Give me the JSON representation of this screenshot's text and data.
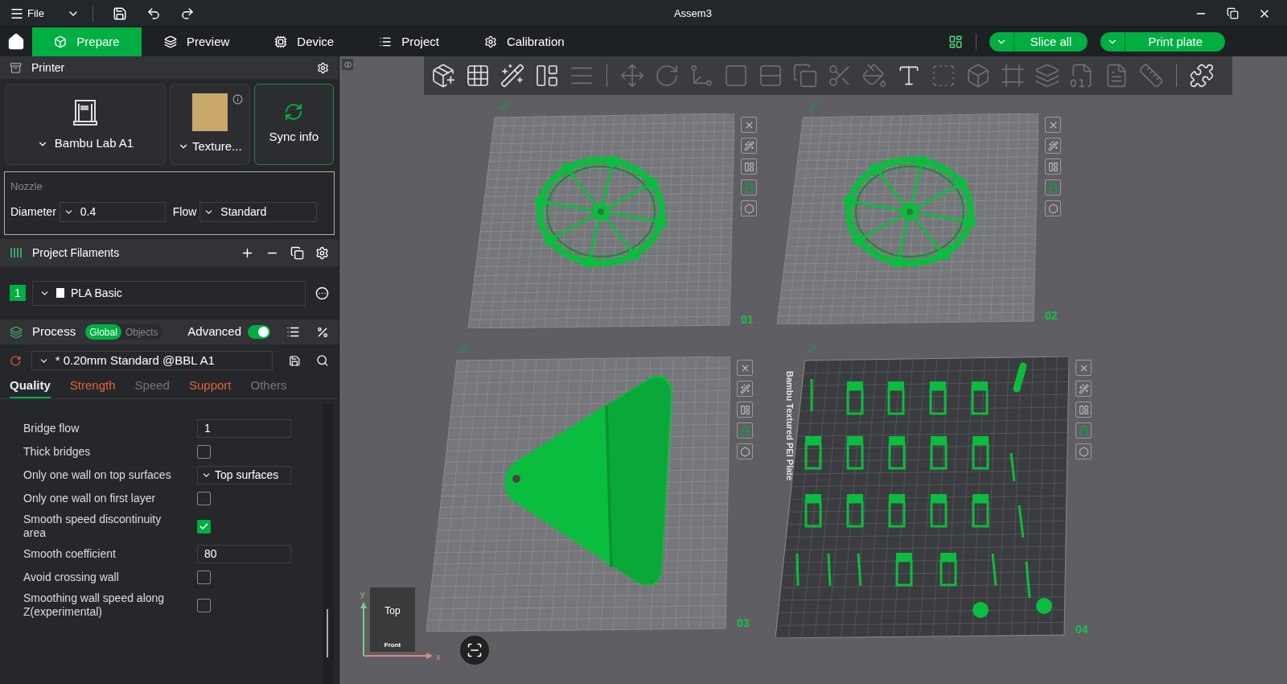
{
  "title_bar": {
    "menu": "File",
    "title": "Assem3"
  },
  "nav": {
    "tabs": [
      {
        "label": "Prepare",
        "selected": true
      },
      {
        "label": "Preview",
        "selected": false
      },
      {
        "label": "Device",
        "selected": false
      },
      {
        "label": "Project",
        "selected": false
      },
      {
        "label": "Calibration",
        "selected": false
      }
    ],
    "actions": [
      "Slice all",
      "Print plate"
    ]
  },
  "printer": {
    "title": "Printer",
    "printer_name": "Bambu Lab A1",
    "plate_type": "Texture...",
    "sync": "Sync info"
  },
  "nozzle": {
    "title": "Nozzle",
    "diameter_label": "Diameter",
    "diameter": "0.4",
    "flow_label": "Flow",
    "flow": "Standard"
  },
  "filaments": {
    "title": "Project Filaments",
    "items": [
      {
        "index": "1",
        "name": "PLA Basic",
        "color": "#00ae42"
      }
    ]
  },
  "process": {
    "title": "Process",
    "scopes": [
      {
        "label": "Global",
        "selected": true
      },
      {
        "label": "Objects",
        "selected": false
      }
    ],
    "advanced_label": "Advanced",
    "advanced": true,
    "preset": "* 0.20mm Standard @BBL A1",
    "tabs": [
      {
        "label": "Quality",
        "selected": true,
        "modified": false
      },
      {
        "label": "Strength",
        "selected": false,
        "modified": true
      },
      {
        "label": "Speed",
        "selected": false,
        "modified": false
      },
      {
        "label": "Support",
        "selected": false,
        "modified": true
      },
      {
        "label": "Others",
        "selected": false,
        "modified": false
      }
    ]
  },
  "settings": [
    {
      "kind": "number",
      "label": "Bridge flow",
      "value": "1"
    },
    {
      "kind": "checkbox",
      "label": "Thick bridges",
      "checked": false
    },
    {
      "kind": "select",
      "label": "Only one wall on top surfaces",
      "value": "Top surfaces"
    },
    {
      "kind": "checkbox",
      "label": "Only one wall on first layer",
      "checked": false
    },
    {
      "kind": "checkbox",
      "label": "Smooth speed discontinuity area",
      "checked": true
    },
    {
      "kind": "number",
      "label": "Smooth coefficient",
      "value": "80"
    },
    {
      "kind": "checkbox",
      "label": "Avoid crossing wall",
      "checked": false
    },
    {
      "kind": "checkbox",
      "label": "Smoothing wall speed along Z(experimental)",
      "checked": false
    }
  ],
  "toolbar": [
    {
      "disabled": false
    },
    {
      "disabled": false
    },
    {
      "disabled": false
    },
    {
      "disabled": false
    },
    {
      "disabled": true
    },
    {
      "disabled": true
    },
    {
      "disabled": true
    },
    {
      "disabled": true
    },
    {
      "disabled": true
    },
    {
      "disabled": true
    },
    {
      "disabled": true
    },
    {
      "disabled": true
    },
    {
      "disabled": true
    },
    {
      "disabled": false
    },
    {
      "disabled": true
    },
    {
      "disabled": true
    },
    {
      "disabled": true
    },
    {
      "disabled": true
    },
    {
      "disabled": true
    },
    {
      "disabled": true
    },
    {
      "disabled": true
    },
    {
      "disabled": false
    }
  ],
  "plates": [
    {
      "number": "01",
      "kind": "wheel"
    },
    {
      "number": "02",
      "kind": "wheel"
    },
    {
      "number": "03",
      "kind": "keychain"
    },
    {
      "number": "04",
      "kind": "clips",
      "bed_label": "Bambu Textured PEI Plate"
    }
  ],
  "view_cube": {
    "top": "Top",
    "front": "Front",
    "x_axis": "x",
    "y_axis": "y"
  }
}
